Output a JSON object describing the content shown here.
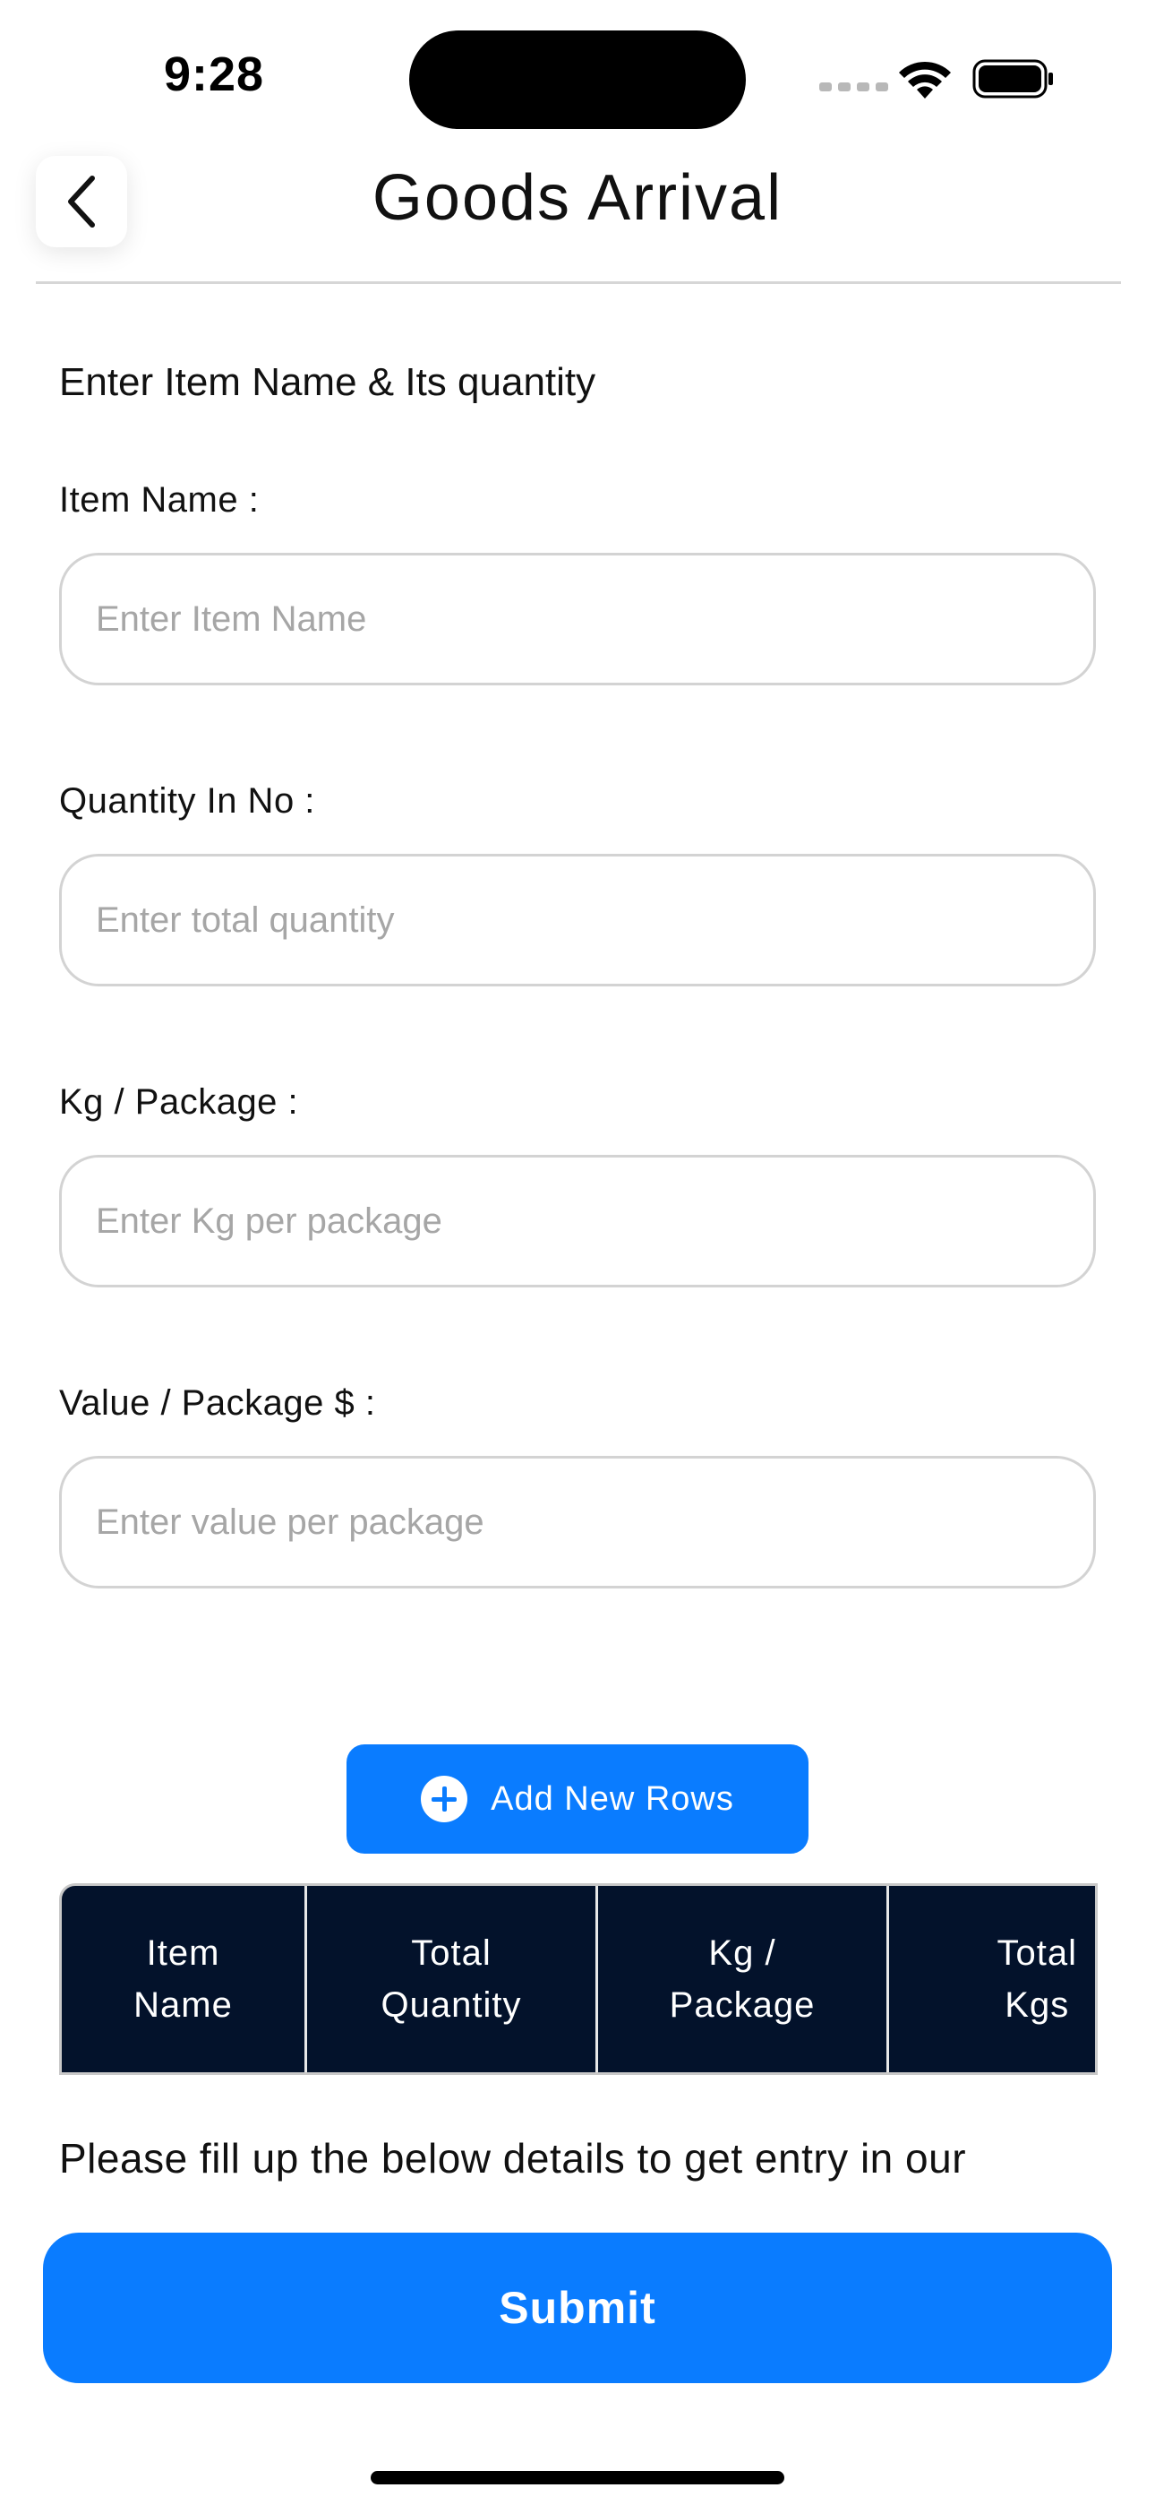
{
  "status_bar": {
    "time": "9:28"
  },
  "header": {
    "title": "Goods Arrival",
    "back_icon": "chevron-left-icon"
  },
  "form": {
    "heading": "Enter Item Name & Its quantity",
    "fields": [
      {
        "label": "Item Name :",
        "placeholder": "Enter Item Name",
        "value": ""
      },
      {
        "label": "Quantity In No :",
        "placeholder": "Enter total quantity",
        "value": ""
      },
      {
        "label": "Kg / Package :",
        "placeholder": "Enter Kg per package",
        "value": ""
      },
      {
        "label": "Value / Package $ :",
        "placeholder": "Enter value per package",
        "value": ""
      }
    ],
    "add_rows_label": "Add New Rows",
    "add_rows_icon": "plus-circle-icon"
  },
  "table": {
    "columns": [
      "Item\nName",
      "Total\nQuantity",
      "Kg /\nPackage",
      "Total\nKgs"
    ]
  },
  "info_text": "Please fill up the below details to get entry in our warehouse",
  "submit_label": "Submit",
  "colors": {
    "primary": "#0a7cff",
    "table_header_bg": "#03122b",
    "input_border": "#d3d3d3",
    "placeholder": "#a6a6a6"
  }
}
